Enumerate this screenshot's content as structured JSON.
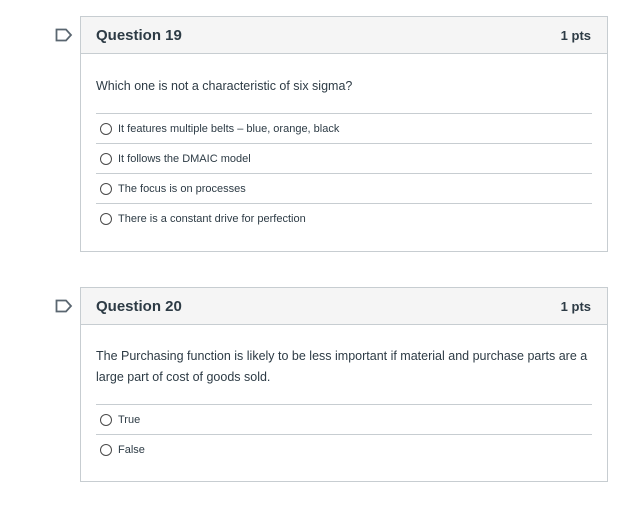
{
  "questions": [
    {
      "title": "Question 19",
      "points": "1 pts",
      "text": "Which one is not a characteristic of six sigma?",
      "answers": [
        "It features multiple belts – blue, orange, black",
        "It follows the DMAIC model",
        "The focus is on processes",
        "There is a constant drive for perfection"
      ]
    },
    {
      "title": "Question 20",
      "points": "1 pts",
      "text": "The Purchasing function is likely to be less important if material and purchase parts are a large part of cost of goods sold.",
      "answers": [
        "True",
        "False"
      ]
    }
  ],
  "icons": {
    "flag": "flag-icon"
  },
  "colors": {
    "header_bg": "#f5f5f5",
    "border": "#c7cdd1",
    "text": "#2d3b45"
  }
}
